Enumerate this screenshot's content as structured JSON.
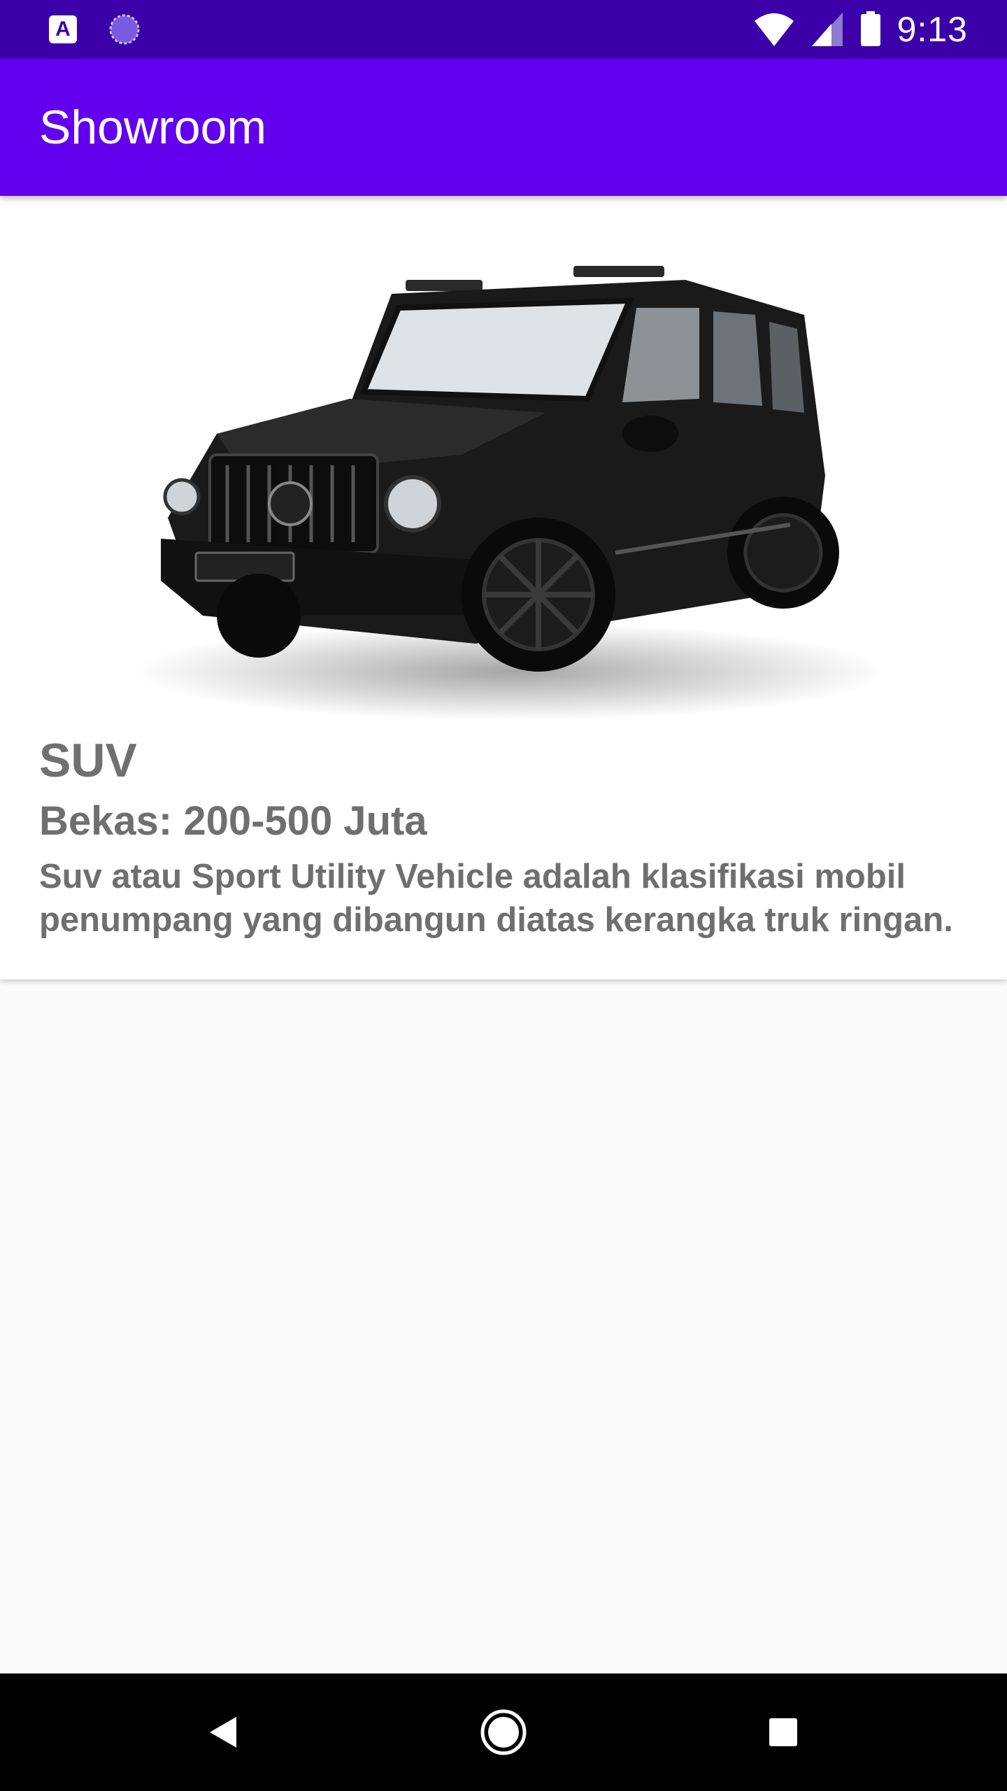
{
  "status_bar": {
    "time": "9:13",
    "icons": [
      "app-a-icon",
      "spinner-icon",
      "wifi-icon",
      "signal-icon",
      "battery-icon"
    ],
    "app_icon_letter": "A"
  },
  "app_bar": {
    "title": "Showroom",
    "color": "#6200ee"
  },
  "cars": [
    {
      "name": "SUV",
      "price": "Bekas: 200-500 Juta",
      "description": "Suv atau Sport Utility Vehicle adalah klasifikasi mobil penumpang yang dibangun diatas kerangka truk ringan.",
      "image_icon": "car-image"
    }
  ],
  "nav_bar": {
    "buttons": [
      "back-icon",
      "home-icon",
      "recents-icon"
    ]
  }
}
